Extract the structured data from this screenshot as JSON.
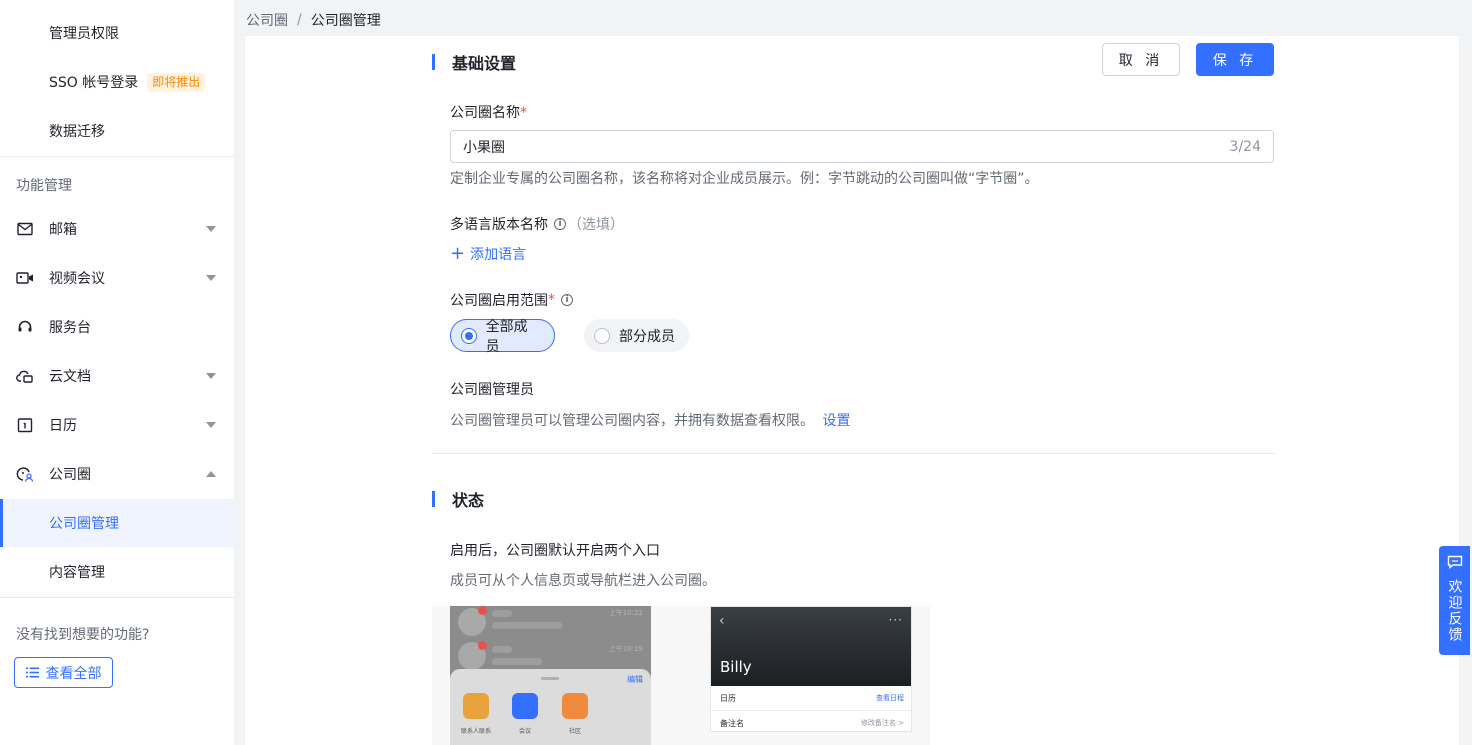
{
  "breadcrumb": {
    "root": "公司圈",
    "separator": "/",
    "current": "公司圈管理"
  },
  "sidebar": {
    "top_items": [
      {
        "label": "管理员权限"
      },
      {
        "label": "SSO 帐号登录",
        "badge": "即将推出"
      },
      {
        "label": "数据迁移"
      }
    ],
    "section_title": "功能管理",
    "groups": [
      {
        "label": "邮箱",
        "icon": "mail-icon",
        "expanded": false
      },
      {
        "label": "视频会议",
        "icon": "video-icon",
        "expanded": false
      },
      {
        "label": "服务台",
        "icon": "headset-icon"
      },
      {
        "label": "云文档",
        "icon": "cloud-doc-icon",
        "expanded": false
      },
      {
        "label": "日历",
        "icon": "calendar-icon",
        "expanded": false
      },
      {
        "label": "公司圈",
        "icon": "moments-icon",
        "expanded": true
      }
    ],
    "sub_items": [
      {
        "label": "公司圈管理",
        "active": true
      },
      {
        "label": "内容管理",
        "active": false
      }
    ],
    "not_found": "没有找到想要的功能?",
    "view_all": "查看全部"
  },
  "main": {
    "basic_title": "基础设置",
    "cancel": "取 消",
    "save": "保 存",
    "name_label": "公司圈名称",
    "required_mark": "*",
    "name_value": "小果圈",
    "name_count": "3/24",
    "name_hint": "定制企业专属的公司圈名称，该名称将对企业成员展示。例：字节跳动的公司圈叫做“字节圈”。",
    "multi_lang_label": "多语言版本名称",
    "optional": "（选填）",
    "add_lang": "添加语言",
    "scope_label": "公司圈启用范围",
    "scope_all": "全部成员",
    "scope_part": "部分成员",
    "scope_selected": "全部成员",
    "admin_label": "公司圈管理员",
    "admin_hint": "公司圈管理员可以管理公司圈内容，并拥有数据查看权限。",
    "admin_link": "设置",
    "status_title": "状态",
    "status_label": "启用后，公司圈默认开启两个入口",
    "status_hint": "成员可从个人信息页或导航栏进入公司圈。"
  },
  "preview": {
    "chat_times": [
      "上午10:22",
      "上午10:19"
    ],
    "edit": "编辑",
    "apps": [
      {
        "label": "联系人联系",
        "color": "#e8a33d"
      },
      {
        "label": "会议",
        "color": "#3370ff"
      },
      {
        "label": "社区",
        "color": "#f08a3c"
      }
    ],
    "profile_name": "Billy",
    "profile_rows": [
      {
        "k": "日历",
        "v": "查看日程"
      },
      {
        "k": "备注名",
        "v": "修改备注名 >"
      }
    ]
  },
  "feedback": {
    "label": "欢迎反馈"
  },
  "colors": {
    "accent": "#3370ff",
    "required": "#f54a45",
    "badge": "#ff8800"
  }
}
